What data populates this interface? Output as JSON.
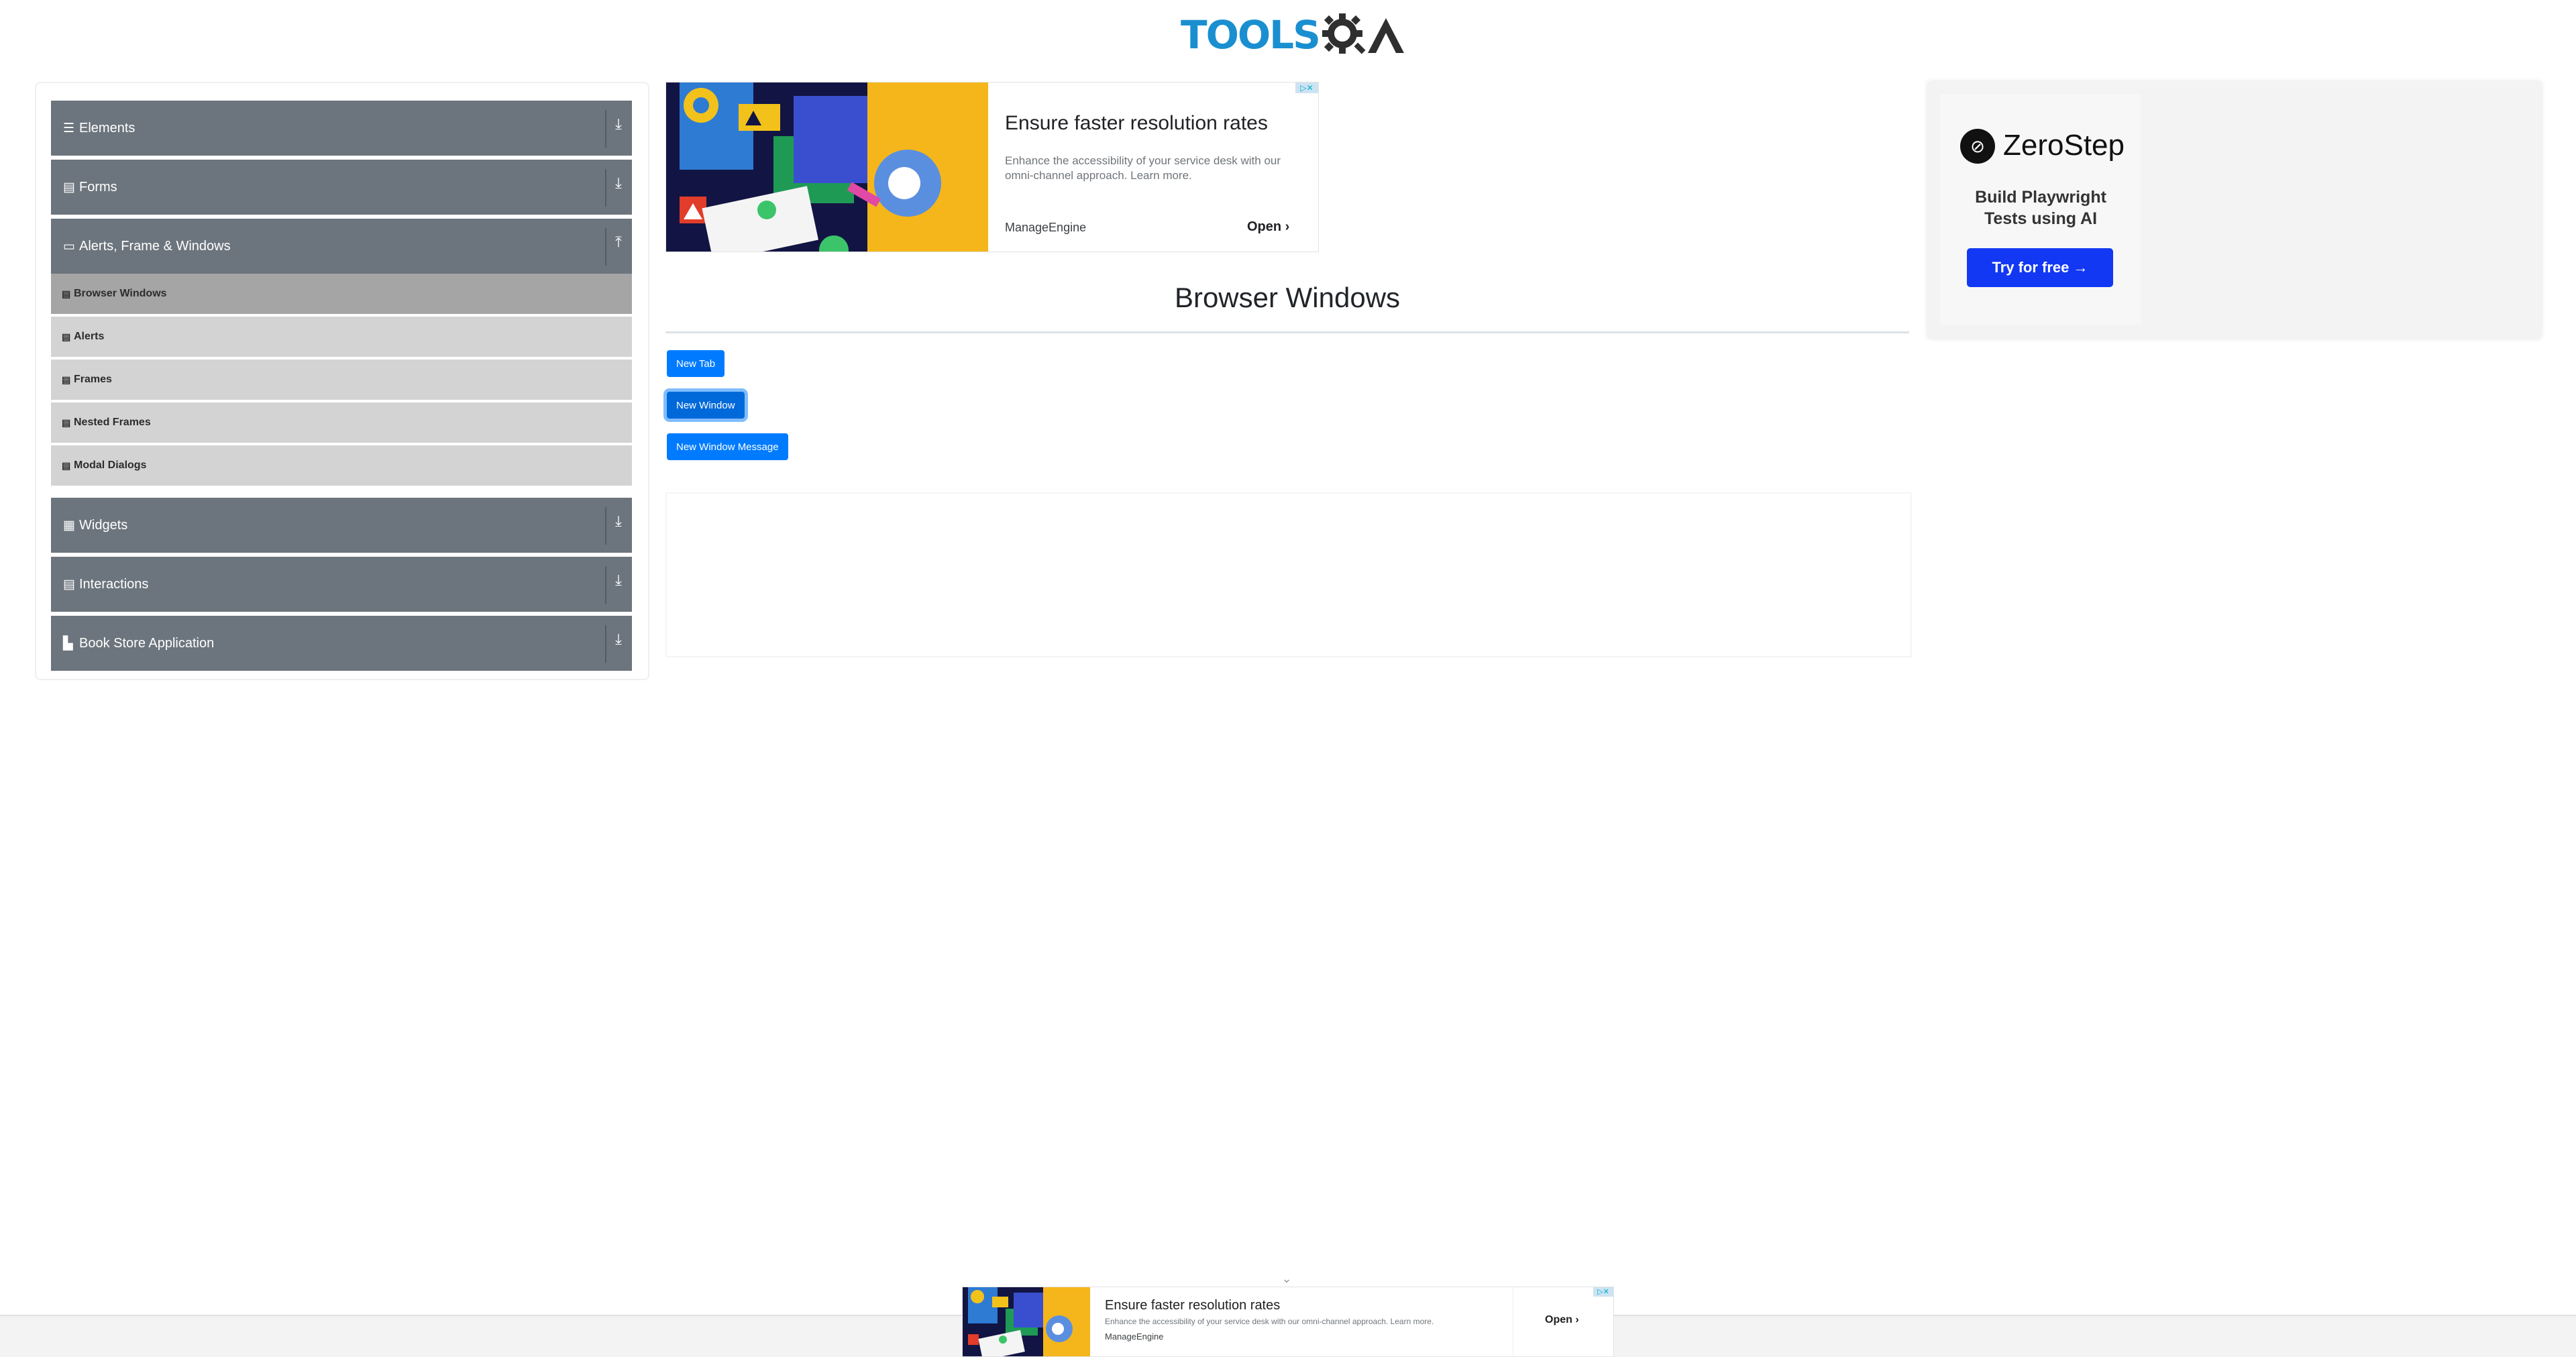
{
  "header": {
    "logo_text": "TOOLS",
    "logo_suffix": "QA"
  },
  "sidebar": {
    "groups": [
      {
        "label": "Elements",
        "icon": "☰",
        "arrow": "⤓"
      },
      {
        "label": "Forms",
        "icon": "▤",
        "arrow": "⤓"
      },
      {
        "label": "Alerts, Frame & Windows",
        "icon": "▭",
        "arrow": "⤒"
      },
      {
        "label": "Widgets",
        "icon": "▦",
        "arrow": "⤓"
      },
      {
        "label": "Interactions",
        "icon": "▤",
        "arrow": "⤓"
      },
      {
        "label": "Book Store Application",
        "icon": "▙",
        "arrow": "⤓"
      }
    ],
    "sub_items": [
      {
        "label": "Browser Windows",
        "icon": "▤"
      },
      {
        "label": "Alerts",
        "icon": "▤"
      },
      {
        "label": "Frames",
        "icon": "▤"
      },
      {
        "label": "Nested Frames",
        "icon": "▤"
      },
      {
        "label": "Modal Dialogs",
        "icon": "▤"
      }
    ],
    "active_sub_item": "Browser Windows"
  },
  "ad_top": {
    "title": "Ensure faster resolution rates",
    "body": "Enhance the accessibility of your service desk with our omni-channel approach. Learn more.",
    "brand": "ManageEngine",
    "open_label": "Open ›",
    "close_mark": "▷✕"
  },
  "main": {
    "title": "Browser Windows",
    "buttons": {
      "new_tab": "New Tab",
      "new_window": "New Window",
      "new_window_message": "New Window Message"
    }
  },
  "ad_right": {
    "brand": "ZeroStep",
    "logo_glyph": "⊘",
    "tagline_line1": "Build Playwright",
    "tagline_line2": "Tests using AI",
    "cta": "Try for free →"
  },
  "ad_bottom": {
    "title": "Ensure faster resolution rates",
    "body": "Enhance the accessibility of your service desk with our omni-channel approach. Learn more.",
    "brand": "ManageEngine",
    "open_label": "Open ›",
    "close_mark": "▷✕",
    "collapse_glyph": "⌄"
  },
  "colors": {
    "accent": "#007bff",
    "sidebar_header": "#6c757d",
    "sub_item": "#d3d3d3",
    "sub_item_active": "#a5a5a5",
    "logo_blue": "#1a8fd0",
    "zerostep_button": "#1338f4"
  }
}
